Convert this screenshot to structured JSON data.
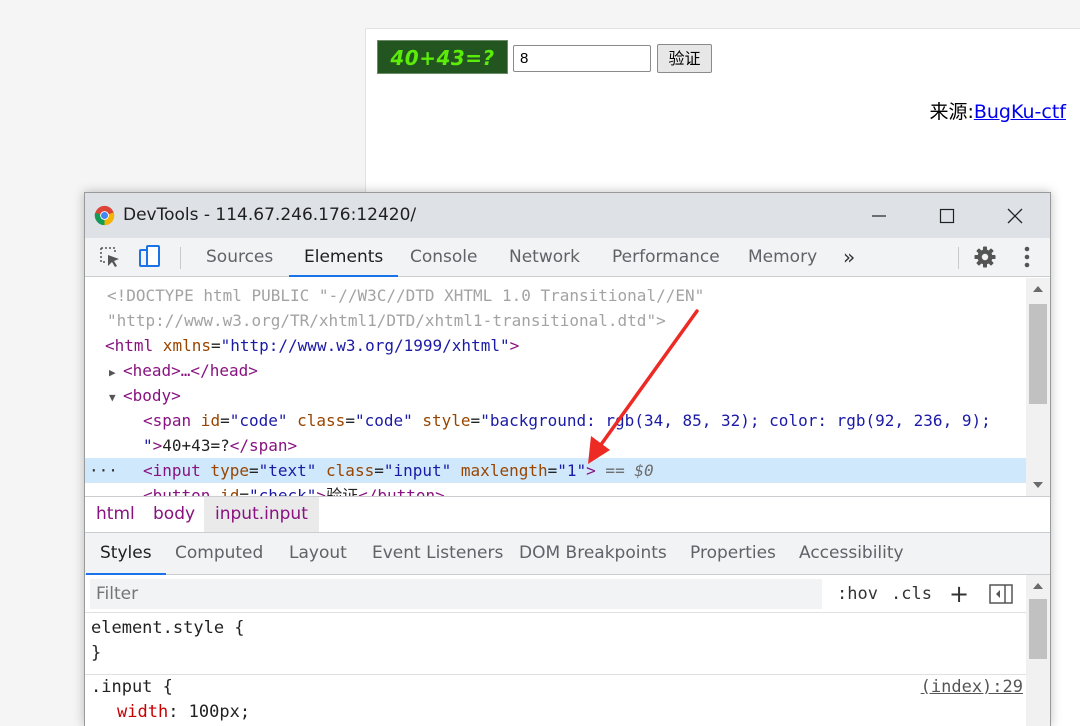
{
  "page": {
    "captcha_text": "40+43=?",
    "answer_value": "8",
    "verify_label": "验证",
    "source_label": "来源:",
    "source_link": "BugKu-ctf"
  },
  "devtools": {
    "window_title": "DevTools - 114.67.246.176:12420/",
    "tabs": [
      {
        "label": "Sources"
      },
      {
        "label": "Elements"
      },
      {
        "label": "Console"
      },
      {
        "label": "Network"
      },
      {
        "label": "Performance"
      },
      {
        "label": "Memory"
      }
    ],
    "active_tab": "Elements",
    "more_tabs_icon": "»",
    "dom_lines": {
      "doctype_1": "<!DOCTYPE html PUBLIC \"-//W3C//DTD XHTML 1.0 Transitional//EN\"",
      "doctype_2": "\"http://www.w3.org/TR/xhtml1/DTD/xhtml1-transitional.dtd\">",
      "html_open_tag": "<html",
      "html_attr_name": " xmlns",
      "html_attr_value": "\"http://www.w3.org/1999/xhtml\"",
      "head_line": "<head>…</head>",
      "body_line": "<body>",
      "span_tag": "<span",
      "span_id_name": " id",
      "span_id_value": "\"code\"",
      "span_class_name": " class",
      "span_class_value": "\"code\"",
      "span_style_name": " style",
      "span_style_value": "\"background: rgb(34, 85, 32); color: rgb(92, 236, 9);",
      "span_style_value_end": "\"",
      "span_text": "40+43=?",
      "span_close": "</span>",
      "input_tag": "<input",
      "input_type_name": " type",
      "input_type_value": "\"text\"",
      "input_class_name": " class",
      "input_class_value": "\"input\"",
      "input_maxlength_name": " maxlength",
      "input_maxlength_value": "\"1\"",
      "input_end": ">",
      "selected_marker": " == $0",
      "button_tag": "<button",
      "button_id_name": " id",
      "button_id_value": "\"check\"",
      "button_text": "验证",
      "button_close": "</button>"
    },
    "breadcrumbs": [
      "html",
      "body",
      "input.input"
    ],
    "subtabs": [
      "Styles",
      "Computed",
      "Layout",
      "Event Listeners",
      "DOM Breakpoints",
      "Properties",
      "Accessibility"
    ],
    "filter_placeholder": "Filter",
    "hov_label": ":hov",
    "cls_label": ".cls",
    "plus_label": "+",
    "styles": {
      "element_style_open": "element.style {",
      "element_style_close": "}",
      "rule_selector": ".input",
      "rule_open_brace": " {",
      "rule_source": "(index):29",
      "prop_name": "width",
      "prop_value": ": 100px;"
    }
  },
  "colors": {
    "captcha_bg": "#225520",
    "captcha_fg": "#5cec09",
    "arrow": "#ee2a24",
    "accent": "#1a73e8"
  }
}
